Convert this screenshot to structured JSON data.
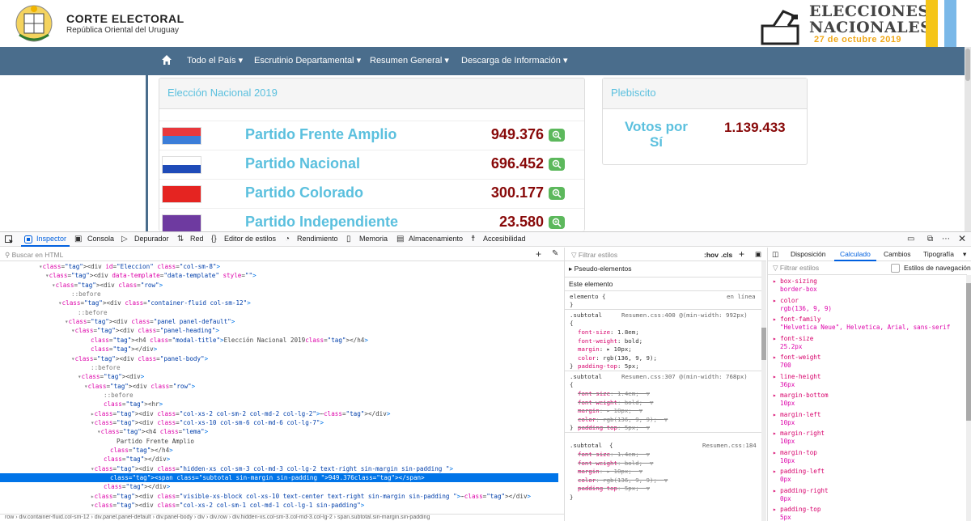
{
  "header": {
    "title": "CORTE ELECTORAL",
    "subtitle": "República Oriental del Uruguay",
    "logo_line1": "ELECCIONES",
    "logo_line2": "NACIONALES",
    "logo_date": "27 de octubre 2019"
  },
  "nav": {
    "items": [
      "Todo el País",
      "Escrutinio Departamental",
      "Resumen General",
      "Descarga de Información"
    ]
  },
  "main_panel": {
    "heading": "Elección Nacional 2019",
    "parties": [
      {
        "name": "Partido Frente Amplio",
        "votes": "949.376",
        "flag": [
          "#e8383d",
          "#3b7dd8"
        ]
      },
      {
        "name": "Partido Nacional",
        "votes": "696.452",
        "flag": [
          "#ffffff",
          "#1f4bb8"
        ]
      },
      {
        "name": "Partido Colorado",
        "votes": "300.177",
        "flag": [
          "#e52421",
          "#e52421"
        ]
      },
      {
        "name": "Partido Independiente",
        "votes": "23.580",
        "flag": [
          "#6e3aa0",
          "#6e3aa0"
        ]
      }
    ]
  },
  "plebiscito": {
    "heading": "Plebiscito",
    "label": "Votos por Sí",
    "votes": "1.139.433"
  },
  "devtools": {
    "tabs": [
      "Inspector",
      "Consola",
      "Depurador",
      "Red",
      "Editor de estilos",
      "Rendimiento",
      "Memoria",
      "Almacenamiento",
      "Accesibilidad"
    ],
    "search_placeholder": "Buscar en HTML",
    "html_lines": [
      {
        "indent": 6,
        "arrow": "▾",
        "text": "<div id=\"Eleccion\" class=\"col-sm-8\">"
      },
      {
        "indent": 7,
        "arrow": "▾",
        "text": "<div data-template=\"data-template\" style=\"\">"
      },
      {
        "indent": 8,
        "arrow": "▾",
        "text": "<div class=\"row\">"
      },
      {
        "indent": 10,
        "arrow": "",
        "text": "::before"
      },
      {
        "indent": 9,
        "arrow": "▾",
        "text": "<div class=\"container-fluid col-sm-12\">"
      },
      {
        "indent": 11,
        "arrow": "",
        "text": "::before"
      },
      {
        "indent": 10,
        "arrow": "▾",
        "text": "<div class=\"panel panel-default\">"
      },
      {
        "indent": 11,
        "arrow": "▾",
        "text": "<div class=\"panel-heading\">"
      },
      {
        "indent": 13,
        "arrow": "",
        "text": "<h4 class=\"modal-title\">Elección Nacional 2019</h4>"
      },
      {
        "indent": 13,
        "arrow": "",
        "text": "</div>"
      },
      {
        "indent": 11,
        "arrow": "▾",
        "text": "<div class=\"panel-body\">"
      },
      {
        "indent": 13,
        "arrow": "",
        "text": "::before"
      },
      {
        "indent": 12,
        "arrow": "▾",
        "text": "<div>"
      },
      {
        "indent": 13,
        "arrow": "▾",
        "text": "<div class=\"row\">"
      },
      {
        "indent": 15,
        "arrow": "",
        "text": "::before"
      },
      {
        "indent": 15,
        "arrow": "",
        "text": "<hr>"
      },
      {
        "indent": 14,
        "arrow": "▸",
        "text": "<div class=\"col-xs-2 col-sm-2 col-md-2 col-lg-2\">⋯</div>"
      },
      {
        "indent": 14,
        "arrow": "▾",
        "text": "<div class=\"col-xs-10 col-sm-6 col-md-6 col-lg-7\">"
      },
      {
        "indent": 15,
        "arrow": "▾",
        "text": "<h4 class=\"lema\">"
      },
      {
        "indent": 17,
        "arrow": "",
        "text": "Partido Frente Amplio"
      },
      {
        "indent": 16,
        "arrow": "",
        "text": "</h4>"
      },
      {
        "indent": 15,
        "arrow": "",
        "text": "</div>"
      },
      {
        "indent": 14,
        "arrow": "▾",
        "text": "<div class=\"hidden-xs col-sm-3 col-md-3 col-lg-2 text-right sin-margin sin-padding \">"
      },
      {
        "indent": 16,
        "arrow": "",
        "text": "<span class=\"subtotal sin-margin sin-padding \">949.376</span>",
        "selected": true
      },
      {
        "indent": 15,
        "arrow": "",
        "text": "</div>"
      },
      {
        "indent": 14,
        "arrow": "▸",
        "text": "<div class=\"visible-xs-block col-xs-10 text-center text-right sin-margin sin-padding \">⋯</div>"
      },
      {
        "indent": 14,
        "arrow": "▾",
        "text": "<div class=\"col-xs-2 col-sm-1 col-md-1 col-lg-1 sin-padding\">"
      }
    ],
    "breadcrumb": "row › div.container-fluid.col-sm-12 › div.panel.panel-default › div.panel-body › div › div.row › div.hidden-xs.col-sm-3.col-md-3.col-lg-2 › span.subtotal.sin-margin.sin-padding",
    "rules": {
      "filter_placeholder": "Filtrar estilos",
      "hov": ":hov",
      "cls": ".cls",
      "pseudo": "Pseudo-elementos",
      "este": "Este elemento",
      "elemento_rule": "elemento { ",
      "en_linea": "en línea",
      "rule1_head": ".subtotal ",
      "rule1_src": "Resumen.css:400 @(min-width: 992px)",
      "rule1_props": [
        "font-size: 1.8em;",
        "font-weight: bold;",
        "margin: ▸ 10px;",
        "color: rgb(136, 9, 9);",
        "padding-top: 5px;"
      ],
      "rule2_head": ".subtotal ",
      "rule2_src": "Resumen.css:307 @(min-width: 768px)",
      "rule2_props": [
        "font-size: 1.4em;",
        "font-weight: bold;",
        "margin: ▸ 10px;",
        "color: rgb(136, 9, 9);",
        "padding-top: 5px;"
      ],
      "rule3_head": ".subtotal  {",
      "rule3_src": "Resumen.css:184",
      "rule3_props": [
        "font-size: 1.4em;",
        "font-weight: bold;",
        "margin: ▸ 10px;",
        "color: rgb(136, 9, 9);",
        "padding-top: 5px;"
      ]
    },
    "computed": {
      "tabs": [
        "Disposición",
        "Calculado",
        "Cambios",
        "Tipografía"
      ],
      "filter_placeholder": "Filtrar estilos",
      "browser_styles": "Estilos de navegación",
      "props": [
        {
          "name": "box-sizing",
          "value": "border-box"
        },
        {
          "name": "color",
          "value": "rgb(136, 9, 9)"
        },
        {
          "name": "font-family",
          "value": "\"Helvetica Neue\", Helvetica, Arial, sans-serif"
        },
        {
          "name": "font-size",
          "value": "25.2px"
        },
        {
          "name": "font-weight",
          "value": "700"
        },
        {
          "name": "line-height",
          "value": "36px"
        },
        {
          "name": "margin-bottom",
          "value": "10px"
        },
        {
          "name": "margin-left",
          "value": "10px"
        },
        {
          "name": "margin-right",
          "value": "10px"
        },
        {
          "name": "margin-top",
          "value": "10px"
        },
        {
          "name": "padding-left",
          "value": "0px"
        },
        {
          "name": "padding-right",
          "value": "0px"
        },
        {
          "name": "padding-top",
          "value": "5px"
        }
      ]
    }
  }
}
